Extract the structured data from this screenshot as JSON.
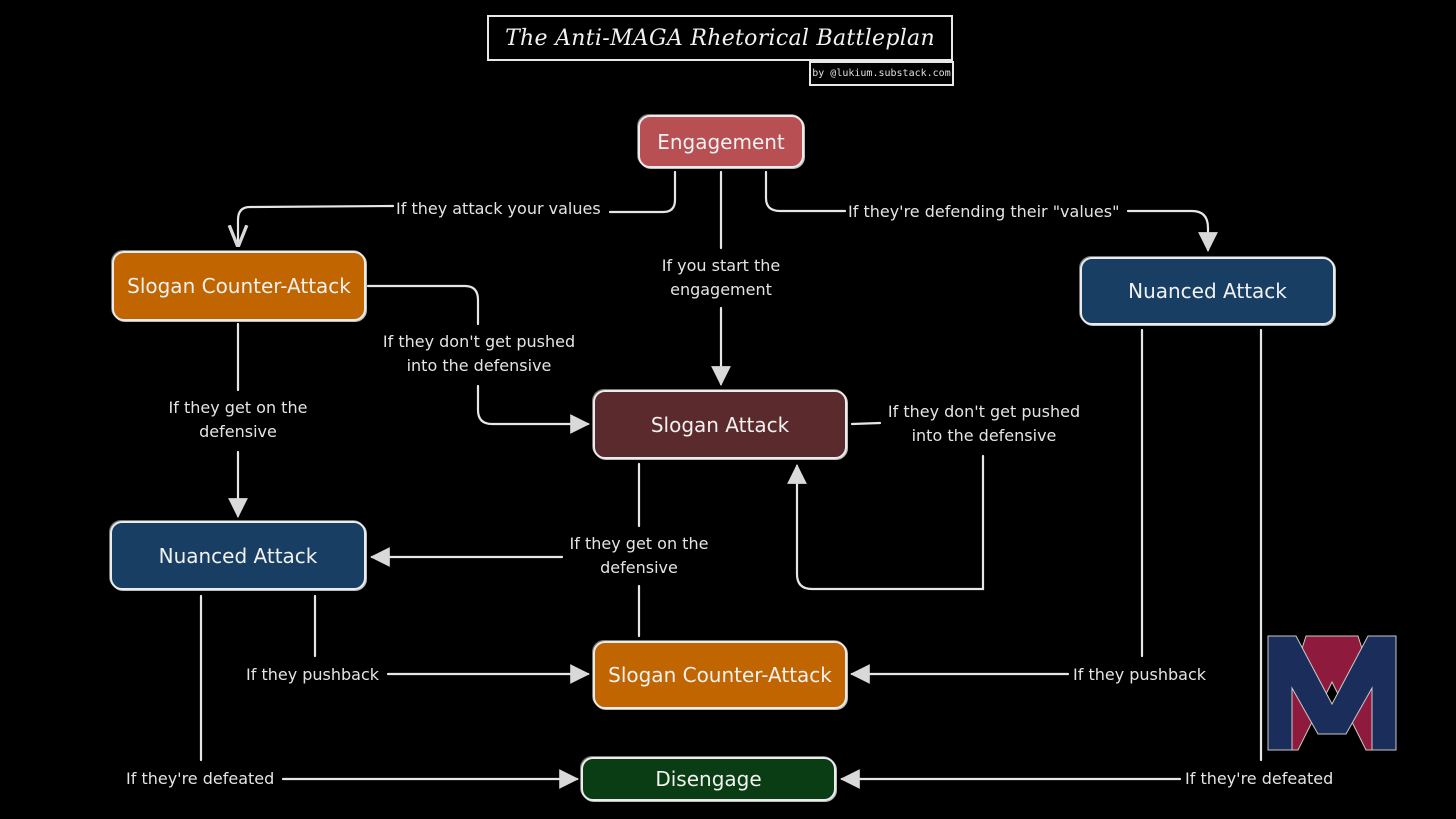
{
  "header": {
    "title": "The Anti-MAGA Rhetorical Battleplan",
    "byline": "by @lukium.substack.com"
  },
  "colors": {
    "engagement": "#b84f52",
    "slogan_counter_attack": "#c06500",
    "nuanced_attack": "#183f63",
    "slogan_attack": "#5a2a2c",
    "disengage": "#0b3d14",
    "logo_blue": "#1b2d5a",
    "logo_red": "#8e1b3d",
    "line": "#e6e6e6"
  },
  "nodes": {
    "engagement": "Engagement",
    "slogan_counter_attack_top": "Slogan Counter-Attack",
    "nuanced_attack_right": "Nuanced Attack",
    "slogan_attack": "Slogan Attack",
    "nuanced_attack_left": "Nuanced Attack",
    "slogan_counter_attack_bottom": "Slogan Counter-Attack",
    "disengage": "Disengage"
  },
  "edges": {
    "attack_values": "If they attack your values",
    "defending_values": "If they're defending their \"values\"",
    "you_start_1": "If you start the",
    "you_start_2": "engagement",
    "not_pushed_left_1": "If they don't get pushed",
    "not_pushed_left_2": "into the defensive",
    "on_defensive_left_1": "If they get on the",
    "on_defensive_left_2": "defensive",
    "not_pushed_right_1": "If they don't get pushed",
    "not_pushed_right_2": "into the defensive",
    "on_defensive_center_1": "If they get on the",
    "on_defensive_center_2": "defensive",
    "pushback_left": "If they pushback",
    "pushback_right": "If they pushback",
    "defeated_left": "If they're defeated",
    "defeated_right": "If they're defeated"
  },
  "logo": {
    "name": "MAGA-slashed monogram logo"
  }
}
